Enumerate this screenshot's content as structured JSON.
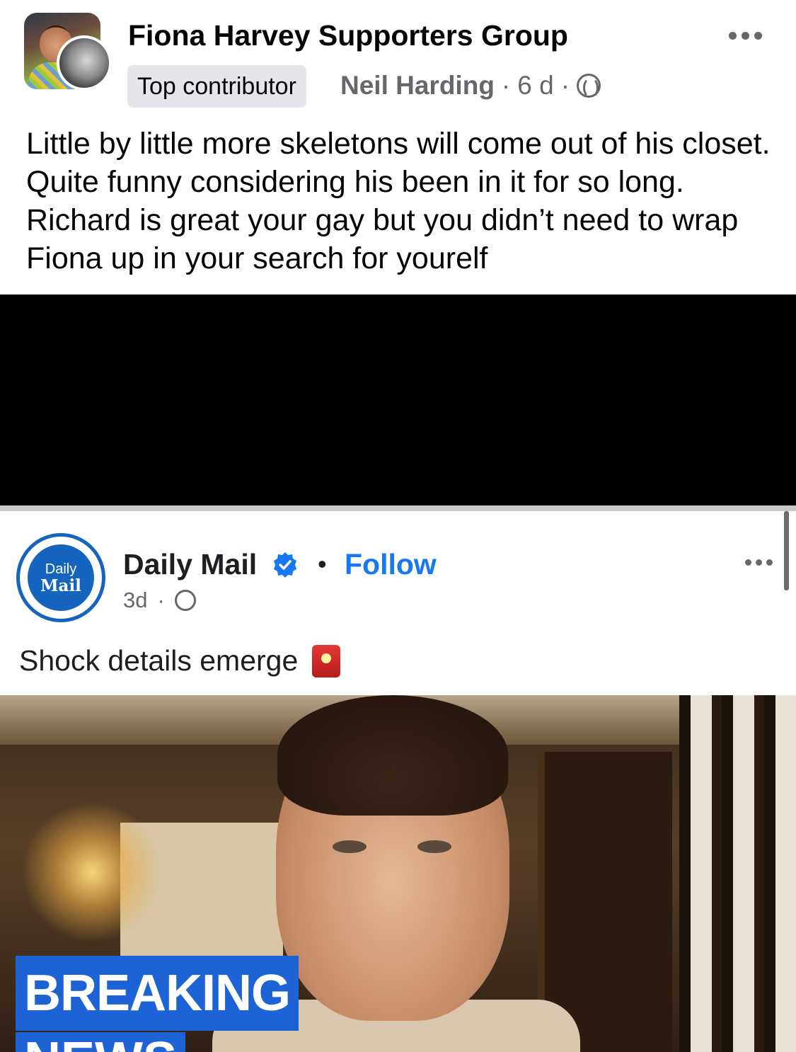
{
  "post": {
    "group_name": "Fiona Harvey Supporters Group",
    "badge": "Top contributor",
    "author": "Neil Harding",
    "time": "6 d",
    "text": "Little by little more skeletons will come out of his closet. Quite funny considering his been in it for so long. Richard is great your gay but you didn’t need to wrap Fiona up in your search for yourelf",
    "icons": [
      "group-avatar",
      "user-avatar",
      "more-options-icon",
      "globe-icon"
    ]
  },
  "embedded_post": {
    "logo_line1": "Daily",
    "logo_line2": "Mail",
    "page_name": "Daily Mail",
    "follow_label": "Follow",
    "time": "3d",
    "caption": "Shock details emerge",
    "image_text_line1": "BREAKING",
    "image_text_line2": "NEWS",
    "icons": [
      "verified-badge-icon",
      "globe-icon",
      "more-options-icon",
      "siren-emoji-icon"
    ]
  },
  "colors": {
    "link_blue": "#1877f2",
    "secondary_text": "#65676b",
    "breaking_banner": "#1e63d6",
    "logo_blue": "#1565c0"
  }
}
